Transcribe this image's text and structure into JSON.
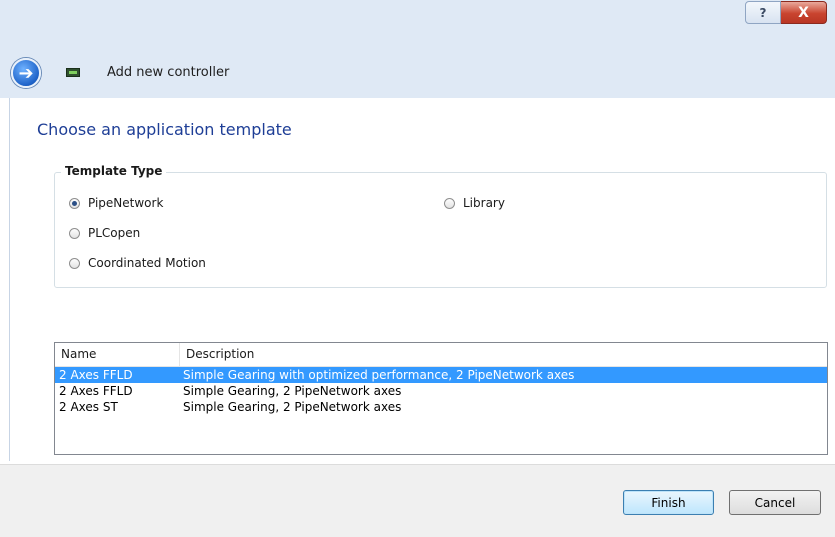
{
  "window": {
    "help_label": "?",
    "close_label": "X"
  },
  "header": {
    "title": "Add new controller"
  },
  "page": {
    "heading": "Choose an application template"
  },
  "template_type": {
    "label": "Template Type",
    "options": [
      {
        "label": "PipeNetwork",
        "checked": true
      },
      {
        "label": "PLCopen",
        "checked": false
      },
      {
        "label": "Coordinated Motion",
        "checked": false
      },
      {
        "label": "Library",
        "checked": false
      }
    ]
  },
  "templates": {
    "columns": [
      "Name",
      "Description"
    ],
    "rows": [
      {
        "name": "2 Axes FFLD",
        "description": "Simple Gearing with optimized performance, 2 PipeNetwork axes",
        "selected": true
      },
      {
        "name": "2 Axes FFLD",
        "description": "Simple Gearing, 2 PipeNetwork axes",
        "selected": false
      },
      {
        "name": "2 Axes ST",
        "description": "Simple Gearing, 2 PipeNetwork axes",
        "selected": false
      }
    ]
  },
  "footer": {
    "finish_label": "Finish",
    "cancel_label": "Cancel"
  },
  "colors": {
    "heading": "#1e3e96",
    "selection": "#3399ff",
    "titlebar": "#dfe9f5"
  }
}
